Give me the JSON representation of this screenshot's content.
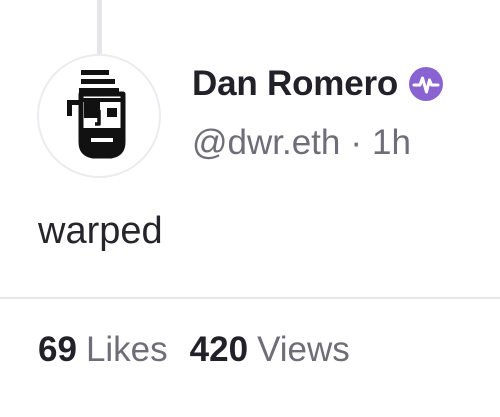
{
  "cast": {
    "author": {
      "display_name": "Dan Romero",
      "handle": "@dwr.eth",
      "verified_icon": "verified-badge-icon",
      "verified_color": "#8a63d2",
      "avatar_icon": "pirate-avatar-icon"
    },
    "timestamp": "1h",
    "meta_separator": "·",
    "text": "warped",
    "stats": {
      "likes_count": "69",
      "likes_label": "Likes",
      "views_count": "420",
      "views_label": "Views"
    }
  },
  "colors": {
    "primary_text": "#222129",
    "secondary_text": "#6f6e78",
    "divider": "#e7e6eb",
    "thread_line": "#e6e5ea"
  }
}
